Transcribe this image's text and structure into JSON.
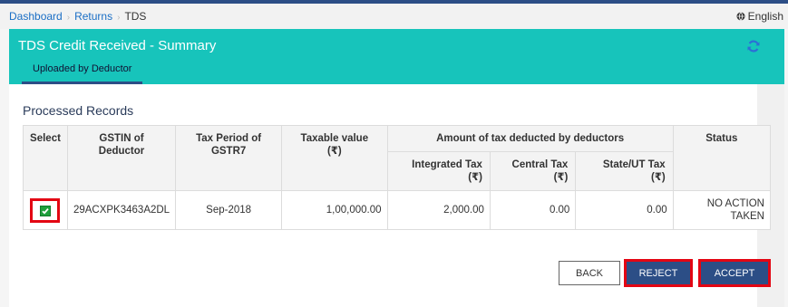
{
  "breadcrumb": {
    "items": [
      "Dashboard",
      "Returns"
    ],
    "current": "TDS"
  },
  "language": {
    "label": "English",
    "icon": "globe-icon"
  },
  "panel": {
    "title": "TDS Credit Received - Summary",
    "tab": "Uploaded by Deductor",
    "refresh_icon": "refresh-icon",
    "header_color": "#17c4bb"
  },
  "section_title": "Processed Records",
  "table": {
    "headers": {
      "select": "Select",
      "gstin_line1": "GSTIN of",
      "gstin_line2": "Deductor",
      "period_line1": "Tax Period of",
      "period_line2": "GSTR7",
      "taxable_line1": "Taxable value",
      "taxable_line2": "(₹)",
      "amount_group": "Amount of tax deducted by deductors",
      "status": "Status",
      "integrated_line1": "Integrated Tax",
      "integrated_line2": "(₹)",
      "central_line1": "Central Tax",
      "central_line2": "(₹)",
      "state_line1": "State/UT Tax",
      "state_line2": "(₹)"
    },
    "rows": [
      {
        "checked": true,
        "gstin": "29ACXPK3463A2DL",
        "period": "Sep-2018",
        "taxable": "1,00,000.00",
        "integrated": "2,000.00",
        "central": "0.00",
        "state": "0.00",
        "status_line1": "NO ACTION",
        "status_line2": "TAKEN"
      }
    ]
  },
  "buttons": {
    "back": "BACK",
    "reject": "REJECT",
    "accept": "ACCEPT"
  },
  "colors": {
    "navy": "#2c4e86",
    "teal": "#17c4bb",
    "highlight": "#e30613",
    "check": "#1e9f3c"
  }
}
